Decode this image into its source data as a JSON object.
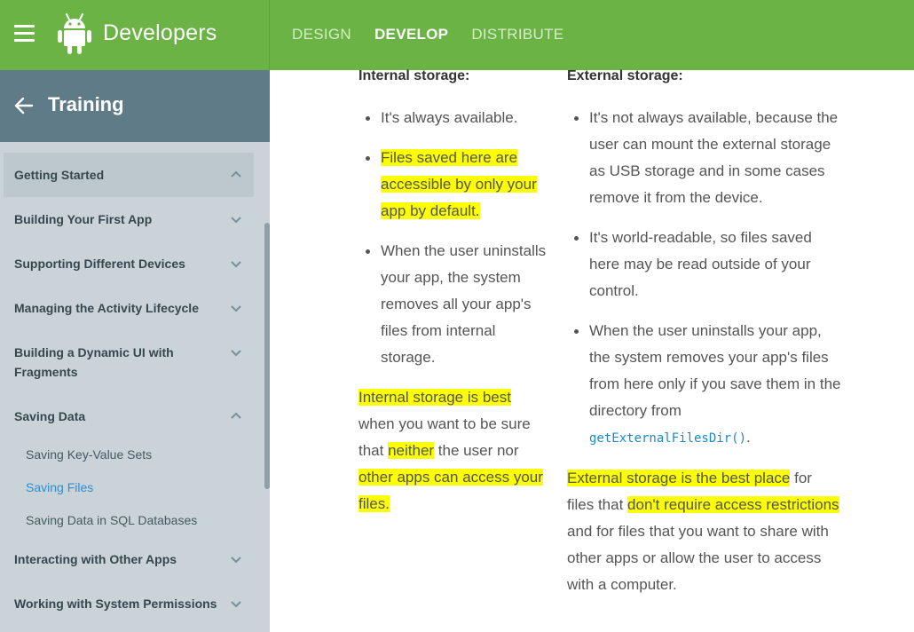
{
  "header": {
    "brand_title": "Developers",
    "nav": [
      "DESIGN",
      "DEVELOP",
      "DISTRIBUTE"
    ],
    "active_nav": "DEVELOP"
  },
  "sidebar": {
    "title": "Training",
    "items": [
      {
        "label": "Getting Started",
        "expanded": true
      },
      {
        "label": "Building Your First App",
        "expanded": false
      },
      {
        "label": "Supporting Different Devices",
        "expanded": false
      },
      {
        "label": "Managing the Activity Lifecycle",
        "expanded": false
      },
      {
        "label": "Building a Dynamic UI with Fragments",
        "expanded": false
      },
      {
        "label": "Saving Data",
        "expanded": true
      },
      {
        "label": "Interacting with Other Apps",
        "expanded": false
      },
      {
        "label": "Working with System Permissions",
        "expanded": false
      }
    ],
    "sub_items": [
      "Saving Key-Value Sets",
      "Saving Files",
      "Saving Data in SQL Databases"
    ],
    "active_sub_item": "Saving Files"
  },
  "content": {
    "internal": {
      "heading": "Internal storage:",
      "bullet1": "It's always available.",
      "bullet2_hl": "Files saved here are accessible by only your app by default.",
      "bullet3": "When the user uninstalls your app, the system removes all your app's files from internal storage.",
      "para_hl1": "Internal storage is best",
      "para_mid1": " when you want to be sure that ",
      "para_hl2": "neither",
      "para_mid2": " the user nor ",
      "para_hl3": "other apps can access your files."
    },
    "external": {
      "heading": "External storage:",
      "bullet1": "It's not always available, because the user can mount the external storage as USB storage and in some cases remove it from the device.",
      "bullet2": "It's world-readable, so files saved here may be read outside of your control.",
      "bullet3": "When the user uninstalls your app, the system removes your app's files from here only if you save them in the directory from ",
      "bullet3_code": "getExternalFilesDir()",
      "bullet3_end": ".",
      "para_hl1": "External storage is the best place",
      "para_mid1": " for files that ",
      "para_hl2": "don't require access restrictions",
      "para_end": " and for files that you want to share with other apps or allow the user to access with a computer."
    }
  },
  "colors": {
    "header_green": "#6ab344",
    "sidebar_header": "#5e7b87",
    "sidebar_bg": "#c9d3d8",
    "highlight": "#fbff00",
    "link_blue": "#2d8fd5"
  }
}
